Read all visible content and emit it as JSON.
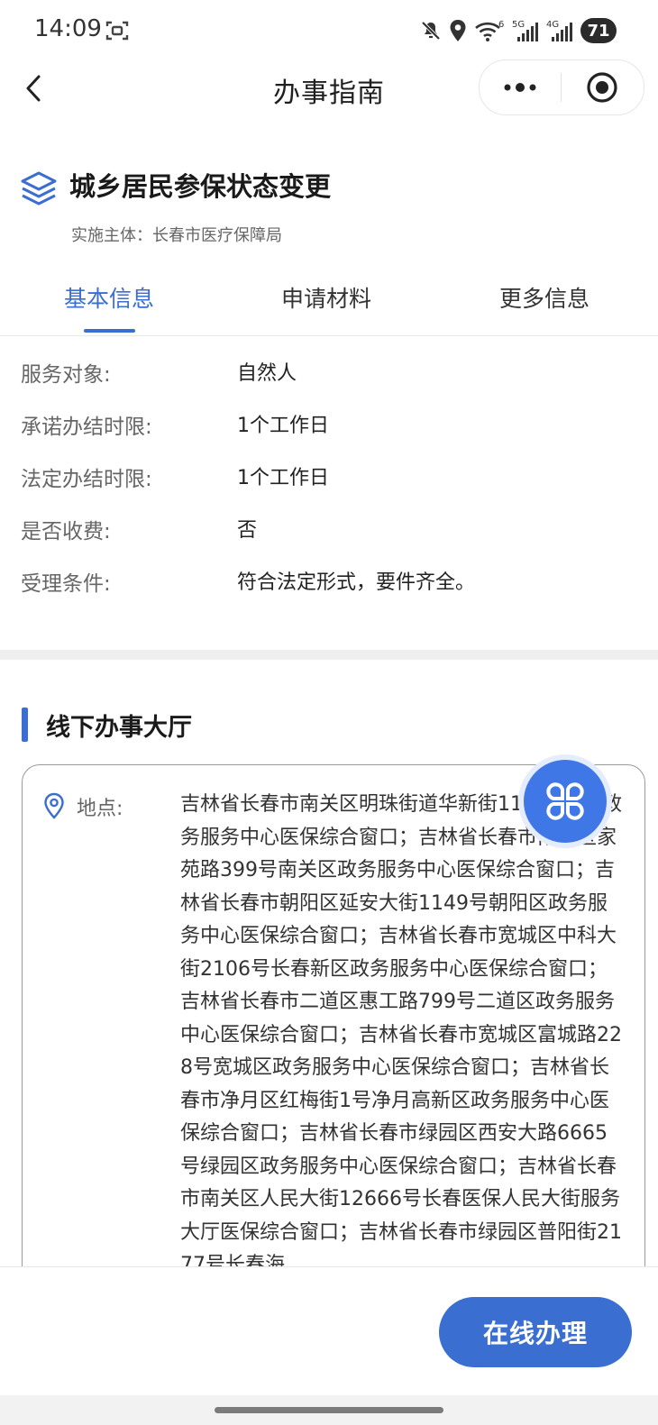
{
  "status_bar": {
    "time": "14:09",
    "network_wifi_label": "6",
    "network_5g_label": "5G",
    "network_4g_label": "4G",
    "battery": "71"
  },
  "nav": {
    "title": "办事指南"
  },
  "service": {
    "title": "城乡居民参保状态变更",
    "implementer": "实施主体：长春市医疗保障局"
  },
  "tabs": [
    {
      "label": "基本信息",
      "active": true
    },
    {
      "label": "申请材料",
      "active": false
    },
    {
      "label": "更多信息",
      "active": false
    }
  ],
  "basic_info": [
    {
      "label": "服务对象:",
      "value": "自然人"
    },
    {
      "label": "承诺办结时限:",
      "value": "1个工作日"
    },
    {
      "label": "法定办结时限:",
      "value": "1个工作日"
    },
    {
      "label": "是否收费:",
      "value": "否"
    },
    {
      "label": "受理条件:",
      "value": "符合法定形式，要件齐全。"
    }
  ],
  "offline_hall": {
    "section_title": "线下办事大厅",
    "location_label": "地点:",
    "location_text": "吉林省长春市南关区明珠街道华新街11号长春市政务服务中心医保综合窗口；吉林省长春市南关区家苑路399号南关区政务服务中心医保综合窗口；吉林省长春市朝阳区延安大街1149号朝阳区政务服务中心医保综合窗口；吉林省长春市宽城区中科大街2106号长春新区政务服务中心医保综合窗口；吉林省长春市二道区惠工路799号二道区政务服务中心医保综合窗口；吉林省长春市宽城区富城路228号宽城区政务服务中心医保综合窗口；吉林省长春市净月区红梅街1号净月高新区政务服务中心医保综合窗口；吉林省长春市绿园区西安大路6665号绿园区政务服务中心医保综合窗口；吉林省长春市南关区人民大街12666号长春医保人民大街服务大厅医保综合窗口；吉林省长春市绿园区普阳街2177号长春海"
  },
  "bottom": {
    "online_button": "在线办理"
  },
  "colors": {
    "accent": "#3a6ed0",
    "float_button": "#3f78e6"
  },
  "icons": [
    "back-icon",
    "more-dots-icon",
    "close-target-icon",
    "layers-icon",
    "location-pin-icon",
    "menu-grid-icon"
  ]
}
